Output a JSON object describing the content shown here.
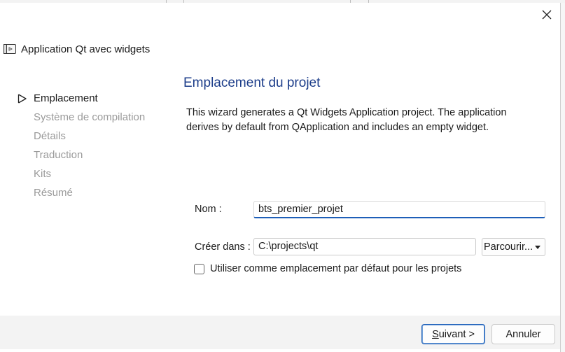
{
  "window": {
    "title": "Application Qt avec widgets",
    "app_icon": "qt-app-window-icon",
    "close_icon": "close-icon"
  },
  "steps": [
    {
      "label": "Emplacement",
      "active": true
    },
    {
      "label": "Système de compilation",
      "active": false
    },
    {
      "label": "Détails",
      "active": false
    },
    {
      "label": "Traduction",
      "active": false
    },
    {
      "label": "Kits",
      "active": false
    },
    {
      "label": "Résumé",
      "active": false
    }
  ],
  "page": {
    "heading": "Emplacement du projet",
    "description": "This wizard generates a Qt Widgets Application project. The application derives by default from QApplication and includes an empty widget."
  },
  "form": {
    "name_label": "Nom :",
    "name_value": "bts_premier_projet",
    "create_in_label": "Créer dans :",
    "create_in_value": "C:\\projects\\qt",
    "browse_label": "Parcourir...",
    "default_location_label": "Utiliser comme emplacement par défaut pour les projets",
    "default_location_checked": false
  },
  "buttons": {
    "next_accel": "S",
    "next_rest": "uivant >",
    "cancel": "Annuler"
  },
  "colors": {
    "heading": "#1c3d8a",
    "accent": "#1e5fb8",
    "inactive_step": "#9a9a9a"
  }
}
